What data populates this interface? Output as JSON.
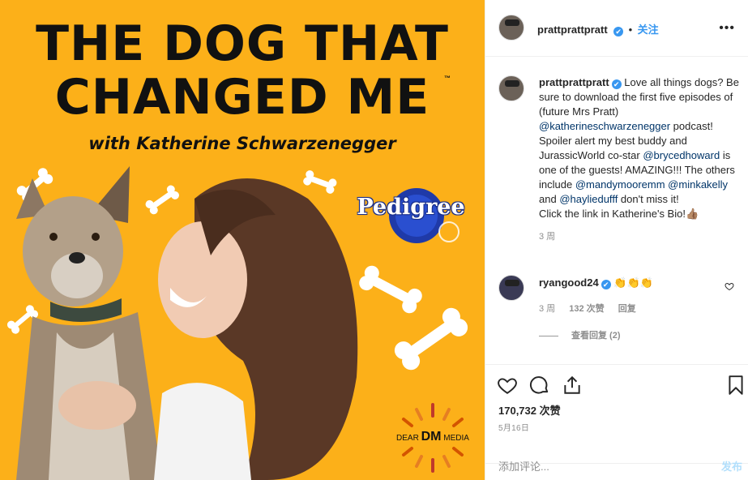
{
  "media": {
    "title_line1": "THE DOG THAT",
    "title_line2": "CHANGED ME",
    "trademark": "™",
    "subtitle": "with Katherine Schwarzenegger",
    "brand": "Pedigree",
    "logo_prefix": "DEAR",
    "logo_mark": "DM",
    "logo_suffix": "MEDIA",
    "bg_color": "#fcb019"
  },
  "header": {
    "username": "prattprattpratt",
    "verified_icon": "✔",
    "follow_label": "关注",
    "more_icon": "•••"
  },
  "caption": {
    "username": "prattprattpratt",
    "part1": "Love all things dogs? Be sure to download the first five episodes of (future Mrs Pratt) ",
    "mention1": "@katherineschwarzenegger",
    "part2": " podcast! Spoiler alert my best buddy and JurassicWorld co-star ",
    "mention2": "@brycedhoward",
    "part3": " is one of the guests! AMAZING!!! The others include ",
    "mention3": "@mandymooremm",
    "part4": " ",
    "mention4": "@minkakelly",
    "part5": " and ",
    "mention5": "@hayliedufff",
    "part6": " don't miss it!",
    "line_last": "Click the link in Katherine's Bio!👍🏽",
    "time": "3 周"
  },
  "comment": {
    "username": "ryangood24",
    "text": "👏👏👏",
    "time": "3 周",
    "likes": "132 次赞",
    "reply_label": "回复",
    "view_replies": "查看回复 (2)"
  },
  "actions": {
    "likes_count": "170,732 次赞",
    "date": "5月16日"
  },
  "add_comment": {
    "placeholder": "添加评论...",
    "post_label": "发布"
  }
}
